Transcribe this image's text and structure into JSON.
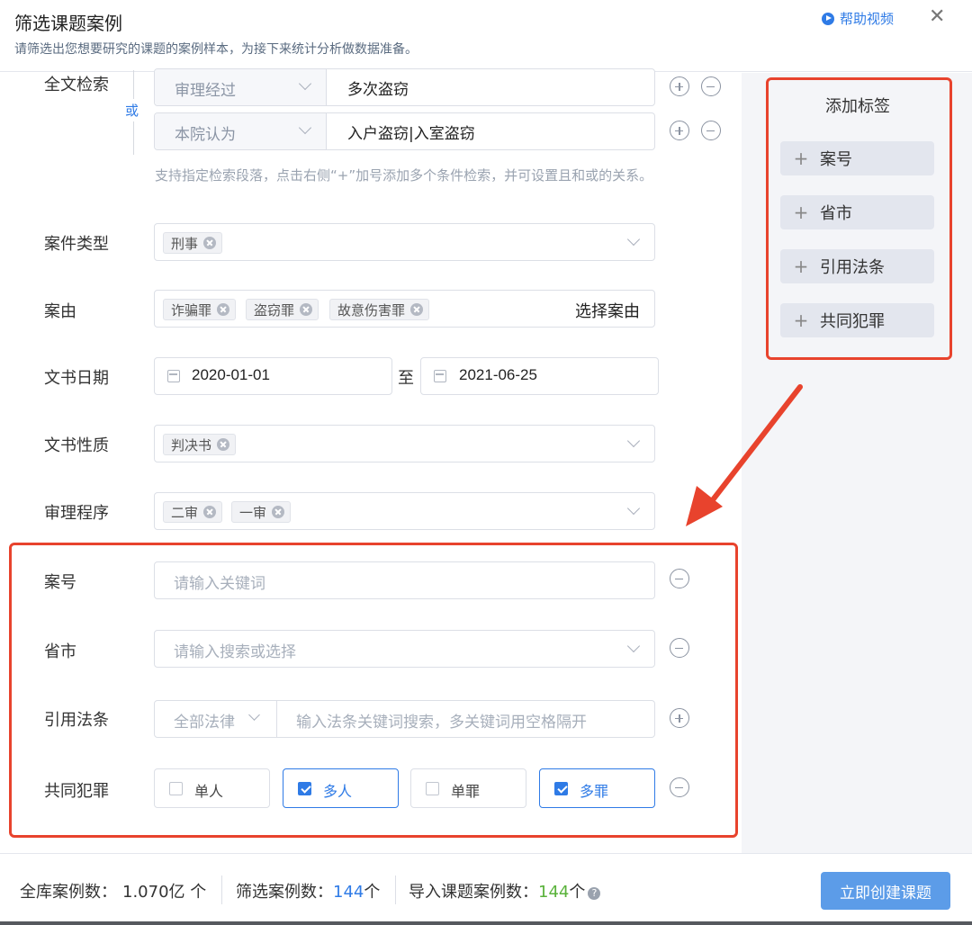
{
  "header": {
    "title": "筛选课题案例",
    "subtitle": "请筛选出您想要研究的课题的案例样本，为接下来统计分析做数据准备。",
    "help_label": "帮助视频"
  },
  "fulltext": {
    "label": "全文检索",
    "or_label": "或",
    "rows": [
      {
        "field": "审理经过",
        "value": "多次盗窃"
      },
      {
        "field": "本院认为",
        "value": "入户盗窃|入室盗窃"
      }
    ],
    "hint": "支持指定检索段落，点击右侧“+”加号添加多个条件检索，并可设置且和或的关系。"
  },
  "case_type": {
    "label": "案件类型",
    "chips": [
      "刑事"
    ]
  },
  "cause": {
    "label": "案由",
    "chips": [
      "诈骗罪",
      "盗窃罪",
      "故意伤害罪"
    ],
    "action": "选择案由"
  },
  "doc_date": {
    "label": "文书日期",
    "from": "2020-01-01",
    "to_label": "至",
    "to": "2021-06-25"
  },
  "doc_nature": {
    "label": "文书性质",
    "chips": [
      "判决书"
    ]
  },
  "procedure": {
    "label": "审理程序",
    "chips": [
      "二审",
      "一审"
    ]
  },
  "case_no": {
    "label": "案号",
    "placeholder": "请输入关键词"
  },
  "province": {
    "label": "省市",
    "placeholder": "请输入搜索或选择"
  },
  "law": {
    "label": "引用法条",
    "select": "全部法律",
    "placeholder": "输入法条关键词搜索，多关键词用空格隔开"
  },
  "joint_crime": {
    "label": "共同犯罪",
    "options": [
      {
        "label": "单人",
        "checked": false
      },
      {
        "label": "多人",
        "checked": true
      },
      {
        "label": "单罪",
        "checked": false
      },
      {
        "label": "多罪",
        "checked": true
      }
    ]
  },
  "tags_panel": {
    "title": "添加标签",
    "items": [
      "案号",
      "省市",
      "引用法条",
      "共同犯罪"
    ]
  },
  "footer": {
    "total_label": "全库案例数：",
    "total_value": "1.070亿 个",
    "filtered_label": "筛选案例数：",
    "filtered_value": "144",
    "filtered_unit": "个",
    "imported_label": "导入课题案例数：",
    "imported_value": "144",
    "imported_unit": "个",
    "create_button": "立即创建课题"
  },
  "colors": {
    "accent": "#2f7be6",
    "highlight": "#e8432d",
    "success": "#59b23a"
  }
}
